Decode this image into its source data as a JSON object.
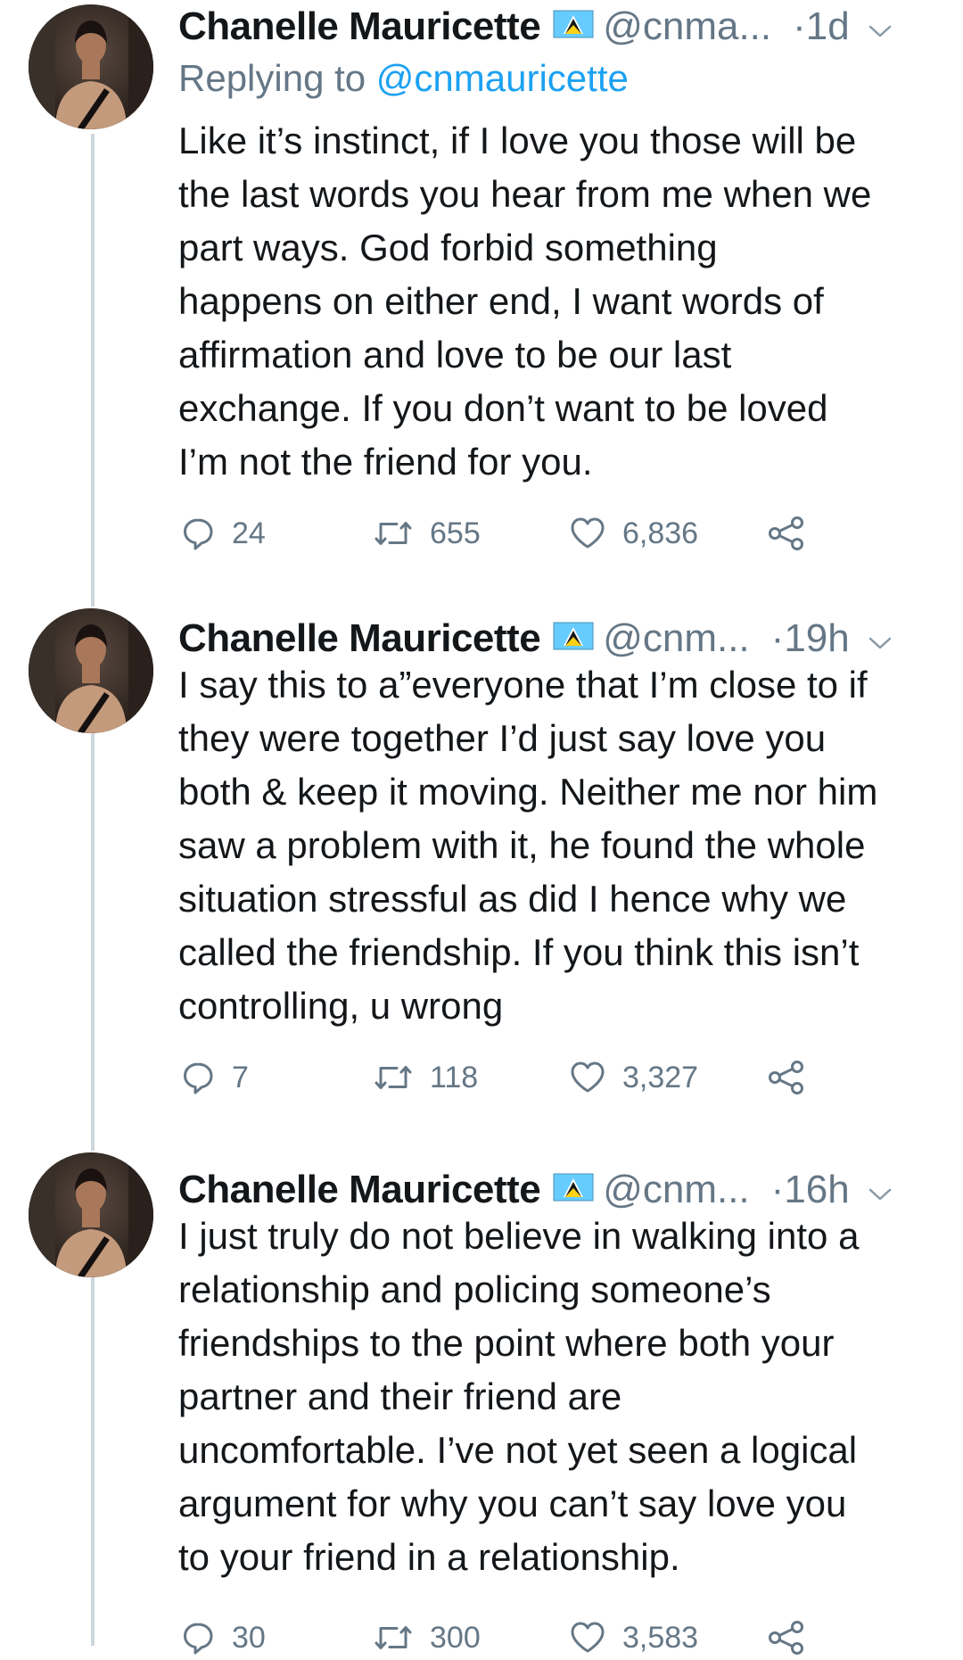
{
  "tweets": [
    {
      "name": "Chanelle Mauricette",
      "handle": "@cnma...",
      "separator": "·",
      "time": "1d",
      "replying_prefix": "Replying to",
      "replying_to": "@cnmauricette",
      "lines": [
        "Like it’s instinct, if I love you those will be",
        "the last words you hear from me when we",
        "part ways. God forbid something",
        "happens on either end, I want words of",
        "affirmation and love to be our last",
        "exchange. If you don’t want to be loved",
        "I’m not the friend for you."
      ],
      "replies": "24",
      "retweets": "655",
      "likes": "6,836"
    },
    {
      "name": "Chanelle Mauricette",
      "handle": "@cnm...",
      "separator": "·",
      "time": "19h",
      "lines": [
        "I say this to a”everyone that I’m close to if",
        "they were together I’d just say love you",
        "both & keep it moving. Neither me nor him",
        "saw a problem with it, he found the whole",
        "situation stressful as did I hence why we",
        "called the friendship. If you think this isn’t",
        "controlling, u wrong"
      ],
      "replies": "7",
      "retweets": "118",
      "likes": "3,327"
    },
    {
      "name": "Chanelle Mauricette",
      "handle": "@cnm...",
      "separator": "·",
      "time": "16h",
      "lines": [
        "I just truly do not believe in walking into a",
        "relationship and policing someone’s",
        "friendships to the point where both your",
        "partner and their friend are",
        "uncomfortable. I’ve not yet seen a logical",
        "argument for why you can’t say love you",
        "to your friend in a relationship."
      ],
      "replies": "30",
      "retweets": "300",
      "likes": "3,583"
    }
  ],
  "icons": {
    "reply": "reply-icon",
    "retweet": "retweet-icon",
    "like": "heart-icon",
    "share": "share-icon",
    "caret": "chevron-down-icon",
    "flag": "flag-icon"
  },
  "colors": {
    "text": "#14171a",
    "secondary": "#657786",
    "link": "#1da1f2",
    "thread_line": "#ccd6dd",
    "flag_blue": "#66ccff"
  }
}
